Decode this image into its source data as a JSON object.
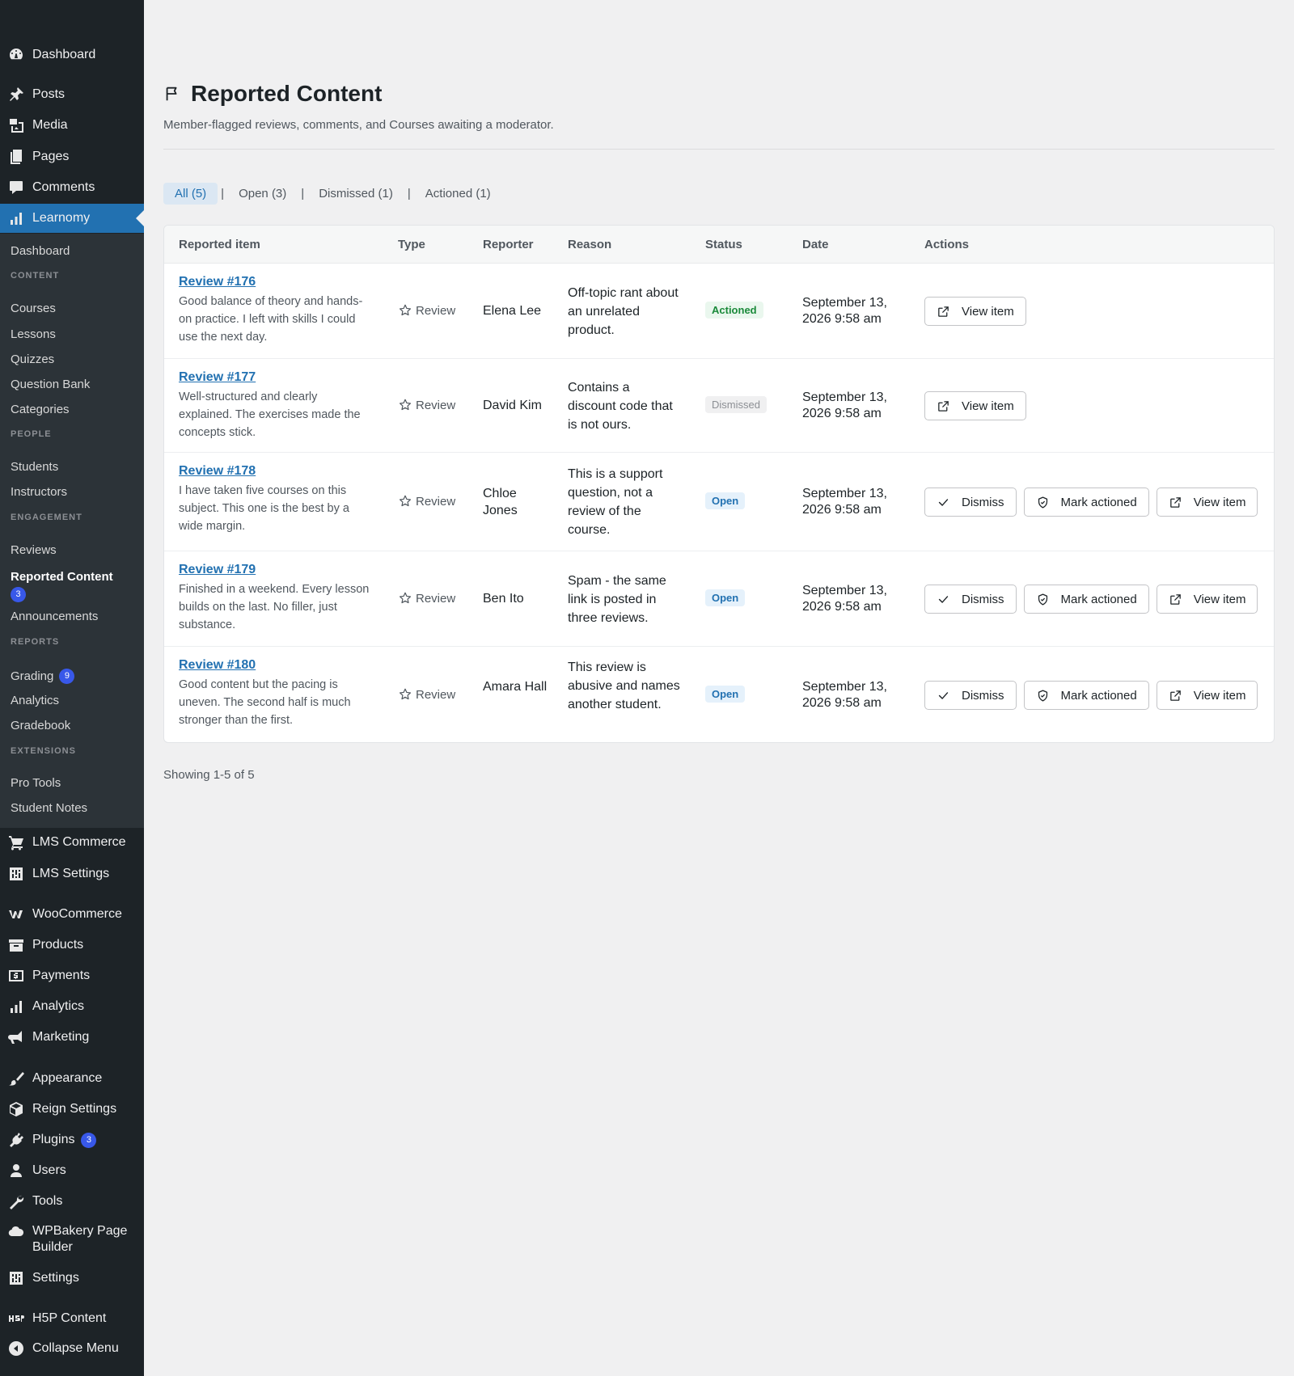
{
  "sidebar": {
    "top_items": [
      {
        "label": "Dashboard",
        "icon": "dashboard-icon"
      },
      {
        "label": "Posts",
        "icon": "pin-icon"
      },
      {
        "label": "Media",
        "icon": "media-icon"
      },
      {
        "label": "Pages",
        "icon": "pages-icon"
      },
      {
        "label": "Comments",
        "icon": "comment-icon"
      },
      {
        "label": "Learnomy",
        "icon": "bar-chart-icon"
      }
    ],
    "submenu": {
      "dashboard": "Dashboard",
      "content_heading": "CONTENT",
      "courses": "Courses",
      "lessons": "Lessons",
      "quizzes": "Quizzes",
      "question_bank": "Question Bank",
      "categories": "Categories",
      "people_heading": "PEOPLE",
      "students": "Students",
      "instructors": "Instructors",
      "engagement_heading": "ENGAGEMENT",
      "reviews": "Reviews",
      "reported_content": "Reported Content",
      "reported_badge": "3",
      "announcements": "Announcements",
      "reports_heading": "REPORTS",
      "grading": "Grading",
      "grading_badge": "9",
      "analytics": "Analytics",
      "gradebook": "Gradebook",
      "extensions_heading": "EXTENSIONS",
      "pro_tools": "Pro Tools",
      "student_notes": "Student Notes"
    },
    "bottom_items": [
      {
        "label": "LMS Commerce",
        "icon": "cart-icon"
      },
      {
        "label": "LMS Settings",
        "icon": "settings-box-icon"
      },
      {
        "label": "WooCommerce",
        "icon": "woocommerce-icon"
      },
      {
        "label": "Products",
        "icon": "archive-icon"
      },
      {
        "label": "Payments",
        "icon": "payments-icon"
      },
      {
        "label": "Analytics",
        "icon": "bar-chart-icon"
      },
      {
        "label": "Marketing",
        "icon": "megaphone-icon"
      },
      {
        "label": "Appearance",
        "icon": "brush-icon"
      },
      {
        "label": "Reign Settings",
        "icon": "cube-icon"
      },
      {
        "label": "Plugins",
        "icon": "plugin-icon",
        "badge": "3"
      },
      {
        "label": "Users",
        "icon": "user-icon"
      },
      {
        "label": "Tools",
        "icon": "wrench-icon"
      },
      {
        "label": "WPBakery Page Builder",
        "icon": "cloud-icon"
      },
      {
        "label": "Settings",
        "icon": "settings-box-icon"
      },
      {
        "label": "H5P Content",
        "icon": "h5p-icon"
      },
      {
        "label": "Collapse Menu",
        "icon": "collapse-icon"
      }
    ]
  },
  "header": {
    "title": "Reported Content",
    "subtitle": "Member-flagged reviews, comments, and Courses awaiting a moderator."
  },
  "filters": [
    {
      "label": "All (5)",
      "active": true
    },
    {
      "label": "Open (3)",
      "active": false
    },
    {
      "label": "Dismissed (1)",
      "active": false
    },
    {
      "label": "Actioned (1)",
      "active": false
    }
  ],
  "table": {
    "columns": [
      "Reported item",
      "Type",
      "Reporter",
      "Reason",
      "Status",
      "Date",
      "Actions"
    ],
    "rows": [
      {
        "item": "Review #176",
        "excerpt": "Good balance of theory and hands-on practice. I left with skills I could use the next day.",
        "type": "Review",
        "reporter": "Elena Lee",
        "reason": "Off-topic rant about an unrelated product.",
        "status": "Actioned",
        "date": "September 13, 2026 9:58 am",
        "actions": [
          "View item"
        ]
      },
      {
        "item": "Review #177",
        "excerpt": "Well-structured and clearly explained. The exercises made the concepts stick.",
        "type": "Review",
        "reporter": "David Kim",
        "reason": "Contains a discount code that is not ours.",
        "status": "Dismissed",
        "date": "September 13, 2026 9:58 am",
        "actions": [
          "View item"
        ]
      },
      {
        "item": "Review #178",
        "excerpt": "I have taken five courses on this subject. This one is the best by a wide margin.",
        "type": "Review",
        "reporter": "Chloe Jones",
        "reason": "This is a support question, not a review of the course.",
        "status": "Open",
        "date": "September 13, 2026 9:58 am",
        "actions": [
          "Dismiss",
          "Mark actioned",
          "View item"
        ]
      },
      {
        "item": "Review #179",
        "excerpt": "Finished in a weekend. Every lesson builds on the last. No filler, just substance.",
        "type": "Review",
        "reporter": "Ben Ito",
        "reason": "Spam - the same link is posted in three reviews.",
        "status": "Open",
        "date": "September 13, 2026 9:58 am",
        "actions": [
          "Dismiss",
          "Mark actioned",
          "View item"
        ]
      },
      {
        "item": "Review #180",
        "excerpt": "Good content but the pacing is uneven. The second half is much stronger than the first.",
        "type": "Review",
        "reporter": "Amara Hall",
        "reason": "This review is abusive and names another student.",
        "status": "Open",
        "date": "September 13, 2026 9:58 am",
        "actions": [
          "Dismiss",
          "Mark actioned",
          "View item"
        ]
      }
    ]
  },
  "footer": {
    "showing": "Showing 1-5 of 5"
  },
  "colors": {
    "accent": "#2271b1",
    "sidebar": "#1d2327",
    "submenu": "#2c3338",
    "badge": "#3858e9",
    "actioned": "#1a8a3a"
  }
}
